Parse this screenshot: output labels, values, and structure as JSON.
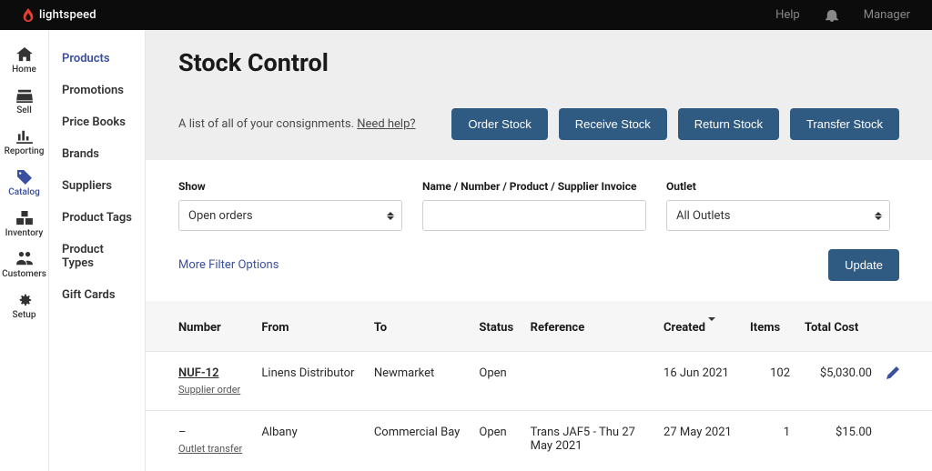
{
  "topbar": {
    "brand": "lightspeed",
    "help": "Help",
    "user": "Manager"
  },
  "rail": [
    {
      "label": "Home",
      "id": "home"
    },
    {
      "label": "Sell",
      "id": "sell"
    },
    {
      "label": "Reporting",
      "id": "reporting"
    },
    {
      "label": "Catalog",
      "id": "catalog",
      "active": true
    },
    {
      "label": "Inventory",
      "id": "inventory"
    },
    {
      "label": "Customers",
      "id": "customers"
    },
    {
      "label": "Setup",
      "id": "setup"
    }
  ],
  "subnav": {
    "items": [
      {
        "label": "Products",
        "active": true
      },
      {
        "label": "Promotions"
      },
      {
        "label": "Price Books"
      },
      {
        "label": "Brands"
      },
      {
        "label": "Suppliers"
      },
      {
        "label": "Product Tags"
      },
      {
        "label": "Product Types"
      },
      {
        "label": "Gift Cards"
      }
    ]
  },
  "page": {
    "title": "Stock Control",
    "subtitle_pre": "A list of all of your consignments. ",
    "need_help": "Need help?"
  },
  "actions": {
    "order": "Order Stock",
    "receive": "Receive Stock",
    "return": "Return Stock",
    "transfer": "Transfer Stock"
  },
  "filters": {
    "show_label": "Show",
    "show_value": "Open orders",
    "search_label": "Name / Number / Product / Supplier Invoice",
    "search_value": "",
    "outlet_label": "Outlet",
    "outlet_value": "All Outlets",
    "more": "More Filter Options",
    "update": "Update"
  },
  "table": {
    "headers": {
      "number": "Number",
      "from": "From",
      "to": "To",
      "status": "Status",
      "reference": "Reference",
      "created": "Created",
      "items": "Items",
      "total_cost": "Total Cost"
    },
    "rows": [
      {
        "number": "NUF-12",
        "sub": "Supplier order ",
        "from": "Linens Distributor",
        "to": "Newmarket",
        "status": "Open",
        "reference": "",
        "created": "16 Jun 2021",
        "items": "102",
        "cost": "$5,030.00",
        "editable": true
      },
      {
        "number": "–",
        "sub": "Outlet transfer ",
        "from": "Albany",
        "to": "Commercial Bay",
        "status": "Open",
        "reference": "Trans JAF5 - Thu 27 May 2021",
        "created": "27 May 2021",
        "items": "1",
        "cost": "$15.00",
        "editable": false
      }
    ]
  }
}
